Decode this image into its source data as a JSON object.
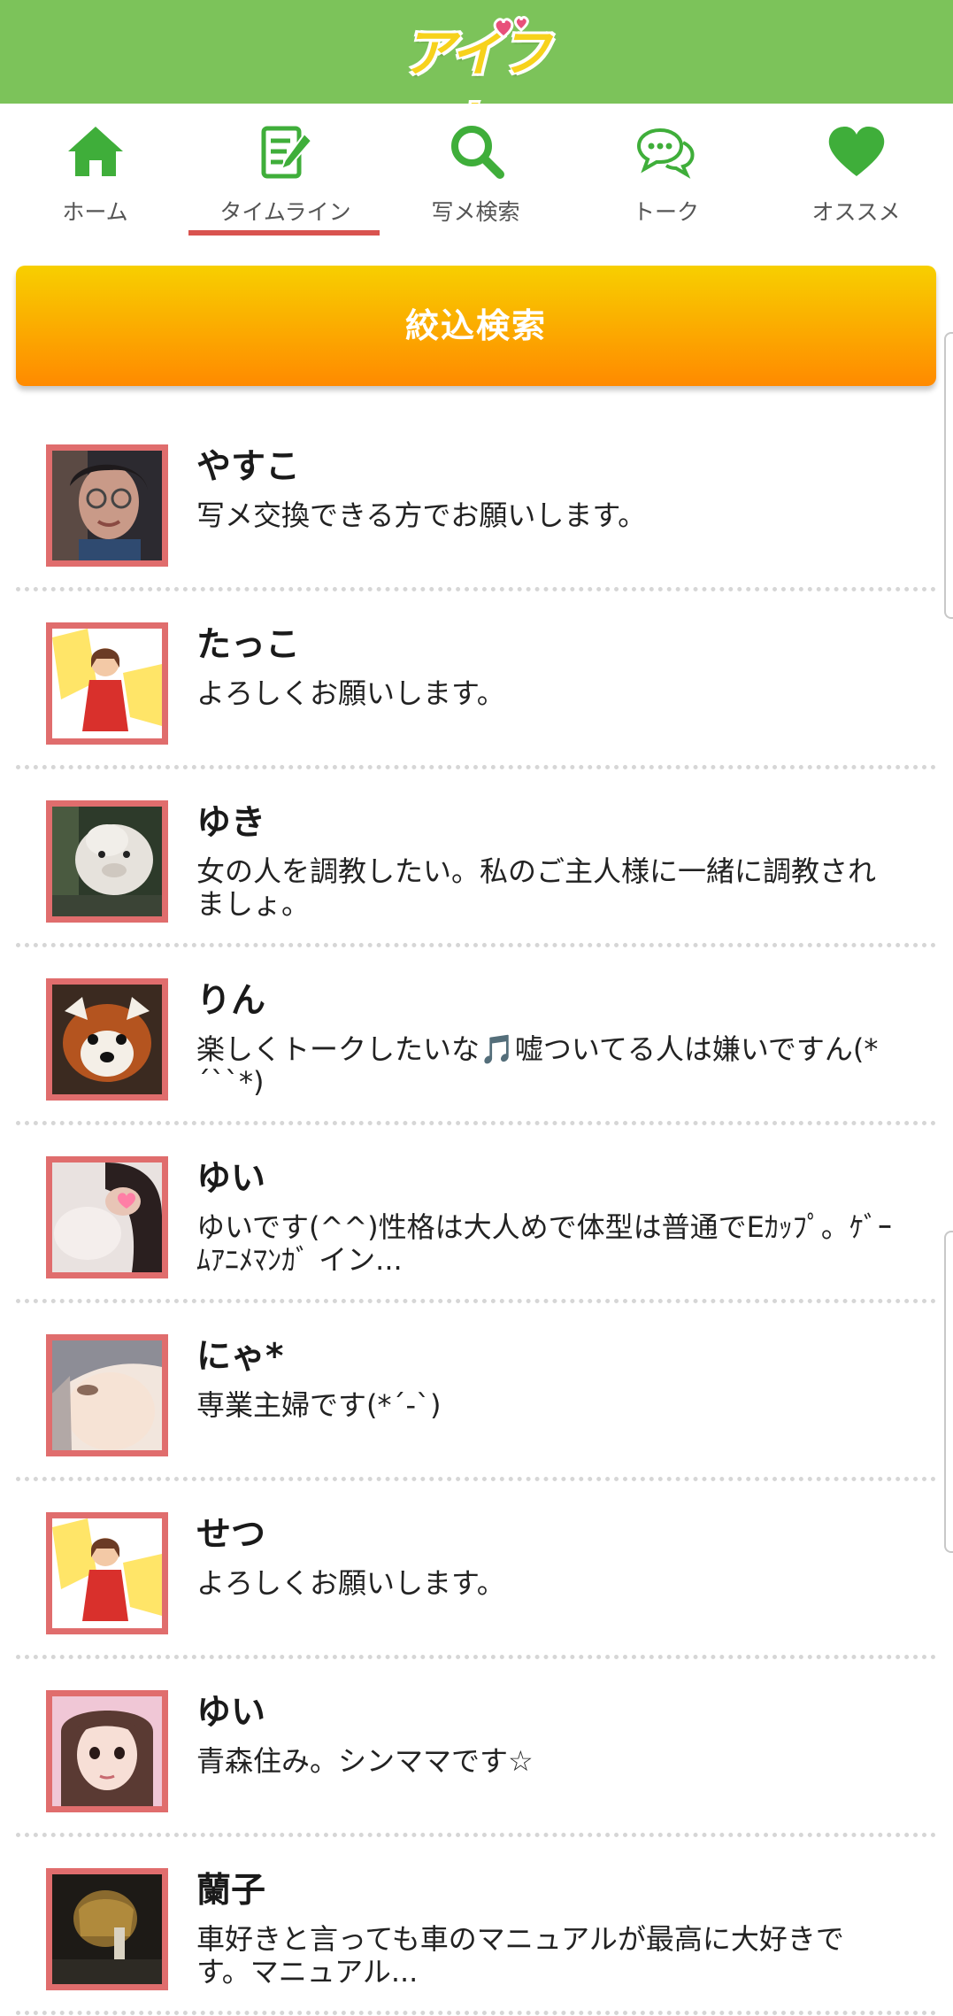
{
  "header": {
    "logo_text": "アイフレ",
    "brand_color": "#7cc35a"
  },
  "nav": {
    "items": [
      {
        "label": "ホーム",
        "icon": "home-icon"
      },
      {
        "label": "タイムライン",
        "icon": "timeline-icon"
      },
      {
        "label": "写メ検索",
        "icon": "search-icon"
      },
      {
        "label": "トーク",
        "icon": "chat-icon"
      },
      {
        "label": "オススメ",
        "icon": "heart-icon"
      }
    ],
    "active_index": 1,
    "active_color": "#d9534f",
    "icon_color": "#3fae3a"
  },
  "search_button": {
    "label": "絞込検索"
  },
  "posts": [
    {
      "name": "やすこ",
      "message": "写メ交換できる方でお願いします。",
      "avatar": "photo"
    },
    {
      "name": "たっこ",
      "message": "よろしくお願いします。",
      "avatar": "default-avatar"
    },
    {
      "name": "ゆき",
      "message": "女の人を調教したい。私のご主人様に一緒に調教されましょ。",
      "avatar": "photo"
    },
    {
      "name": "りん",
      "message": "楽しくトークしたいな🎵嘘ついてる人は嫌いですん(*´``*)",
      "avatar": "photo"
    },
    {
      "name": "ゆい",
      "message": "ゆいです(^^)性格は大人めで体型は普通でEｶｯﾌﾟ。ｹﾞｰﾑｱﾆﾒﾏﾝｶﾞ イン...",
      "avatar": "photo"
    },
    {
      "name": "にゃ*",
      "message": "専業主婦です(*´-`)",
      "avatar": "photo"
    },
    {
      "name": "せつ",
      "message": "よろしくお願いします。",
      "avatar": "default-avatar"
    },
    {
      "name": "ゆい",
      "message": "青森住み。シンママです☆",
      "avatar": "photo"
    },
    {
      "name": "蘭子",
      "message": "車好きと言っても車のマニュアルが最高に大好きです。マニュアル...",
      "avatar": "photo"
    }
  ]
}
